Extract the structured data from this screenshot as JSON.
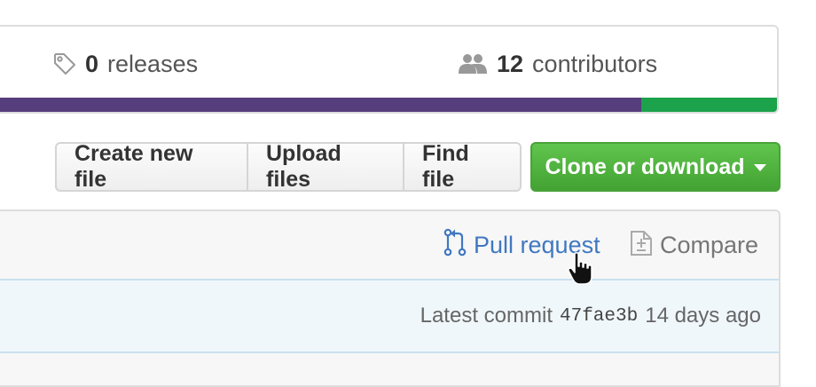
{
  "summary": {
    "releases": {
      "count": "0",
      "label": "releases",
      "icon": "tag-icon"
    },
    "contributors": {
      "count": "12",
      "label": "contributors",
      "icon": "people-icon"
    },
    "language_bar": [
      {
        "share": 0.825,
        "color": "#563d7c"
      },
      {
        "share": 0.175,
        "color": "#1ba24a"
      }
    ]
  },
  "toolbar": {
    "create_new_file": "Create new file",
    "upload_files": "Upload files",
    "find_file": "Find file",
    "clone_or_download": "Clone or download"
  },
  "file_header": {
    "pull_request": {
      "label": "Pull request",
      "icon": "git-pull-request-icon",
      "color": "#4078c0"
    },
    "compare": {
      "label": "Compare",
      "icon": "diff-icon"
    }
  },
  "commit": {
    "prefix": "Latest commit",
    "sha": "47fae3b",
    "age": "14 days ago"
  },
  "colors": {
    "accent_link": "#4078c0",
    "clone_button": "#4eb53d",
    "commit_bar_bg": "#f0f7fb"
  }
}
